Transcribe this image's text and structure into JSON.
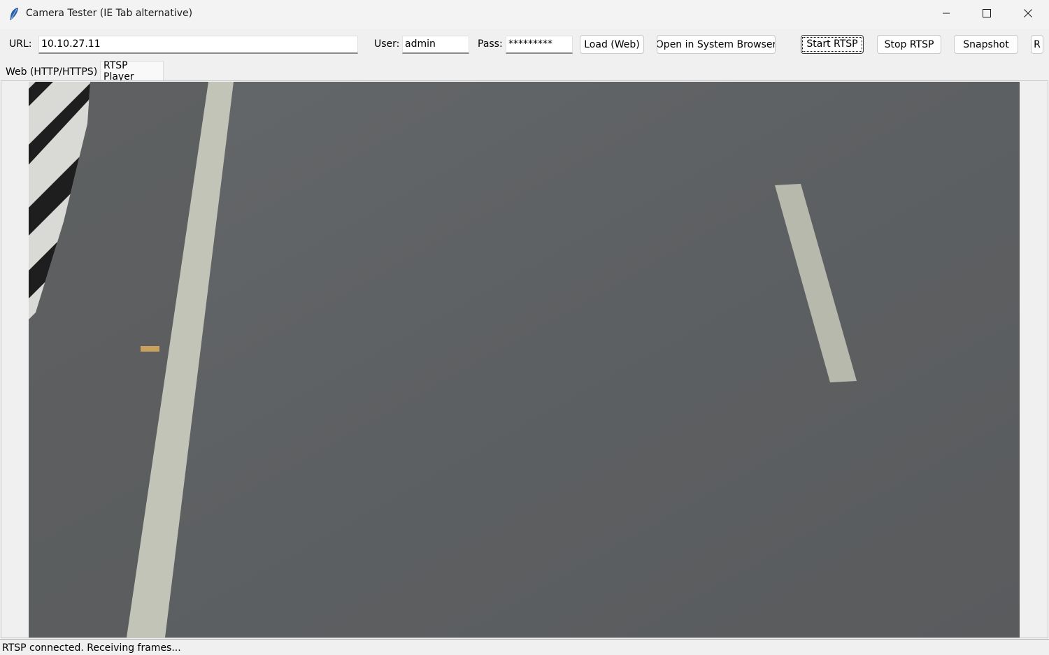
{
  "window": {
    "title": "Camera Tester (IE Tab alternative)"
  },
  "toolbar": {
    "url_label": "URL:",
    "url_value": "10.10.27.11",
    "user_label": "User:",
    "user_value": "admin",
    "pass_label": "Pass:",
    "pass_value": "*********",
    "load_web": "Load (Web)",
    "open_system_browser": "Open in System Browser",
    "start_rtsp": "Start RTSP",
    "stop_rtsp": "Stop RTSP",
    "snapshot": "Snapshot",
    "truncated_button": "R"
  },
  "tabs": [
    {
      "label": "Web (HTTP/HTTPS)",
      "selected": false
    },
    {
      "label": "RTSP Player",
      "selected": true
    }
  ],
  "status": {
    "text": "RTSP connected. Receiving frames..."
  },
  "icons": {
    "app": "feather-icon",
    "minimize": "minimize-icon",
    "maximize": "maximize-icon",
    "close": "close-icon"
  }
}
